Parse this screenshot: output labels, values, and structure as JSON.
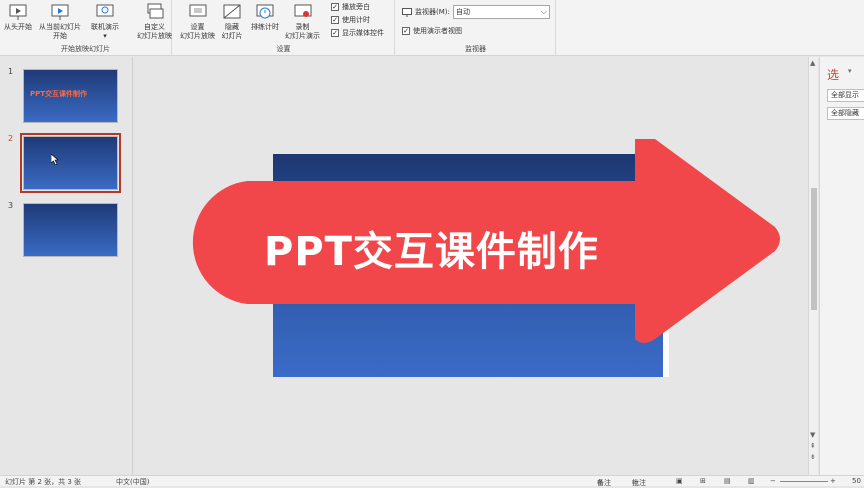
{
  "ribbon": {
    "start_group": {
      "title": "开始放映幻灯片",
      "from_beginning": "从头开始",
      "from_current_l1": "从当前幻灯片",
      "from_current_l2": "开始",
      "online_present": "联机演示",
      "online_present_arrow": "▾",
      "custom_l1": "自定义",
      "custom_l2": "幻灯片放映"
    },
    "setup_group": {
      "title": "设置",
      "setup_show_l1": "设置",
      "setup_show_l2": "幻灯片放映",
      "hide_slide_l1": "隐藏",
      "hide_slide_l2": "幻灯片",
      "rehearse": "排练计时",
      "record_l1": "录制",
      "record_l2": "幻灯片演示",
      "chk_narration": "播放旁白",
      "chk_timings": "使用计时",
      "chk_media": "显示媒体控件"
    },
    "monitor_group": {
      "title": "监视器",
      "monitor_label": "监视器(M):",
      "monitor_value": "自动",
      "presenter_view": "使用演示者视图"
    }
  },
  "thumbnails": [
    {
      "num": "1",
      "title": "PPT交互课件制作"
    },
    {
      "num": "2"
    },
    {
      "num": "3"
    }
  ],
  "slide": {
    "arrow_text": "PPT交互课件制作"
  },
  "right_pane": {
    "title": "选",
    "menu": "▾",
    "show_all": "全部显示",
    "hide_all": "全部隐藏"
  },
  "statusbar": {
    "slide_info": "幻灯片 第 2 张，共 3 张",
    "language": "中文(中国)",
    "notes": "备注",
    "comments": "批注",
    "zoom": "50"
  },
  "colors": {
    "arrow": "#f2474a",
    "accent": "#c4452f",
    "slide_top": "#1e3773",
    "slide_bottom": "#3a6bc8"
  }
}
